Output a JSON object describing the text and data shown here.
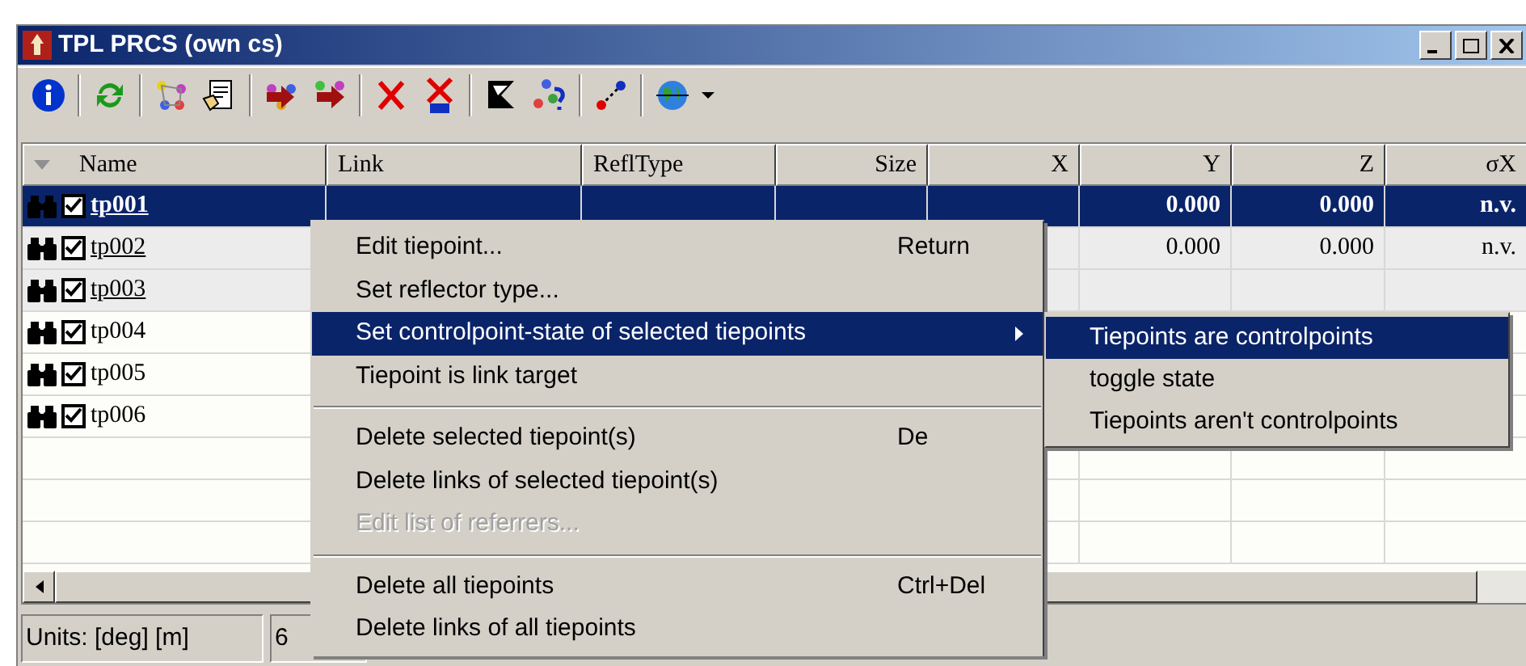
{
  "window": {
    "title": "TPL PRCS (own cs)"
  },
  "table": {
    "columns": [
      {
        "label": "Name",
        "sorted": true
      },
      {
        "label": "Link",
        "sorted": false
      },
      {
        "label": "ReflType",
        "sorted": false
      },
      {
        "label": "Size",
        "sorted": false
      },
      {
        "label": "X",
        "sorted": false
      },
      {
        "label": "Y",
        "sorted": false
      },
      {
        "label": "Z",
        "sorted": false
      },
      {
        "label": "σX",
        "sorted": false
      }
    ],
    "rows": [
      {
        "name": "tp001",
        "checked": true,
        "selected": true,
        "linked": true,
        "values": [
          "0.000",
          "0.000",
          "n.v."
        ]
      },
      {
        "name": "tp002",
        "checked": true,
        "selected": false,
        "linked": true,
        "values": [
          "0.000",
          "0.000",
          "n.v."
        ]
      },
      {
        "name": "tp003",
        "checked": true,
        "selected": false,
        "linked": true
      },
      {
        "name": "tp004",
        "checked": true,
        "selected": false,
        "linked": false
      },
      {
        "name": "tp005",
        "checked": true,
        "selected": false,
        "linked": false
      },
      {
        "name": "tp006",
        "checked": true,
        "selected": false,
        "linked": false
      }
    ]
  },
  "status_bar": [
    {
      "text": "Units: [deg] [m]"
    },
    {
      "text": "6"
    }
  ],
  "context_menu": {
    "items": [
      {
        "kind": "item",
        "label": "Edit tiepoint...",
        "shortcut": "Return",
        "selected": false,
        "disabled": false
      },
      {
        "kind": "item",
        "label": "Set reflector type...",
        "selected": false,
        "disabled": false
      },
      {
        "kind": "submenu",
        "label": "Set controlpoint-state of selected tiepoints",
        "selected": true,
        "disabled": false
      },
      {
        "kind": "item",
        "label": "Tiepoint is link target",
        "selected": false,
        "disabled": false
      },
      {
        "kind": "separator"
      },
      {
        "kind": "item",
        "label": "Delete selected tiepoint(s)",
        "shortcut": "De",
        "selected": false,
        "disabled": false
      },
      {
        "kind": "item",
        "label": "Delete links of selected tiepoint(s)",
        "selected": false,
        "disabled": false
      },
      {
        "kind": "item",
        "label": "Edit list of referrers...",
        "selected": false,
        "disabled": true
      },
      {
        "kind": "separator"
      },
      {
        "kind": "item",
        "label": "Delete all tiepoints",
        "shortcut": "Ctrl+Del",
        "selected": false,
        "disabled": false
      },
      {
        "kind": "item",
        "label": "Delete links of all tiepoints",
        "selected": false,
        "disabled": false
      }
    ]
  },
  "submenu": {
    "items": [
      {
        "label": "Tiepoints are controlpoints",
        "selected": true
      },
      {
        "label": "toggle state",
        "selected": false
      },
      {
        "label": "Tiepoints aren't controlpoints",
        "selected": false
      }
    ]
  }
}
